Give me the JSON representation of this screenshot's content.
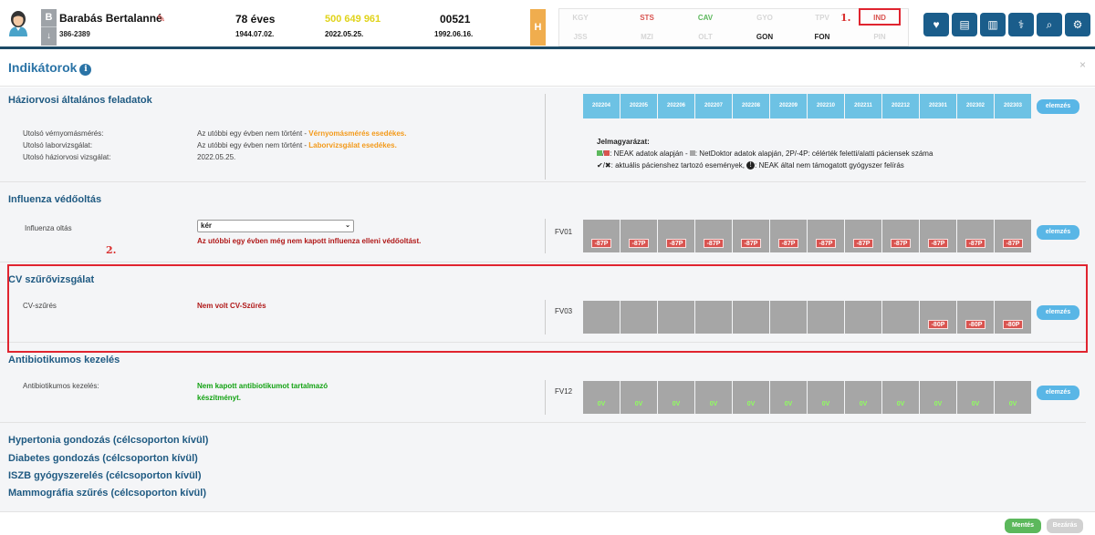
{
  "patient": {
    "initial": "B",
    "name": "Barabás Bertalanné",
    "phone": "386-2389",
    "age": "78 éves",
    "birth_date": "1944.07.02.",
    "taj": "500 649 961",
    "last_visit": "2022.05.25.",
    "code": "00521",
    "code_date": "1992.06.16.",
    "h_label": "H"
  },
  "codes_row1": [
    {
      "label": "KGY",
      "state": "faded"
    },
    {
      "label": "STS",
      "state": "red"
    },
    {
      "label": "CAV",
      "state": "green"
    },
    {
      "label": "GYO",
      "state": "faded"
    },
    {
      "label": "TPV",
      "state": "faded"
    },
    {
      "label": "IND",
      "state": "red"
    }
  ],
  "codes_row2": [
    {
      "label": "JSS",
      "state": "faded"
    },
    {
      "label": "MZI",
      "state": "faded"
    },
    {
      "label": "OLT",
      "state": "faded"
    },
    {
      "label": "GON",
      "state": "dark"
    },
    {
      "label": "FON",
      "state": "dark"
    },
    {
      "label": "PIN",
      "state": "faded"
    }
  ],
  "annotations": {
    "one": "1.",
    "two": "2."
  },
  "colors": {
    "primary": "#1a5d8b",
    "accent": "#59b6e6",
    "highlight": "#e0242f",
    "month": "#6dc2e4"
  },
  "toolbar_icons": [
    "heart-icon",
    "document-icon",
    "books-icon",
    "doctor-icon",
    "search-icon",
    "settings-icon"
  ],
  "modal": {
    "title": "Indikátorok",
    "close": "×",
    "save_label": "Mentés",
    "close_label": "Bezárás"
  },
  "months": [
    "202204",
    "202205",
    "202206",
    "202207",
    "202208",
    "202209",
    "202210",
    "202211",
    "202212",
    "202301",
    "202302",
    "202303"
  ],
  "elemzes_label": "elemzés",
  "haziorvosi": {
    "title": "Háziorvosi általános feladatok",
    "rows": [
      {
        "label": "Utolsó vérnyomásmérés:",
        "value": "Az utóbbi egy évben nem történt - ",
        "warning": "Vérnyomásmérés esedékes."
      },
      {
        "label": "Utolsó laborvizsgálat:",
        "value": "Az utóbbi egy évben nem történt - ",
        "warning": "Laborvizsgálat esedékes."
      },
      {
        "label": "Utolsó háziorvosi vizsgálat:",
        "value": "2022.05.25.",
        "warning": ""
      }
    ],
    "legend": {
      "title": "Jelmagyarázat:",
      "line1": ": NEAK adatok alapján - ",
      "line1b": ": NetDoktor adatok alapján, 2P/-4P: célérték feletti/alatti páciensek száma",
      "line2": "✔/✖: aktuális pácienshez tartozó események, ",
      "line2b": ": NEAK által nem támogatott gyógyszer felírás"
    }
  },
  "influenza": {
    "title": "Influenza védőoltás",
    "label": "Influenza oltás",
    "select_value": "kér",
    "message": "Az utóbbi egy évben még nem kapott influenza elleni védőoltást.",
    "code": "FV01",
    "badges": [
      "-87P",
      "-87P",
      "-87P",
      "-87P",
      "-87P",
      "-87P",
      "-87P",
      "-87P",
      "-87P",
      "-87P",
      "-87P",
      "-87P"
    ]
  },
  "cv": {
    "title": "CV szűrővizsgálat",
    "label": "CV-szűrés",
    "message": "Nem volt CV-Szűrés",
    "code": "FV03",
    "badges": [
      "",
      "",
      "",
      "",
      "",
      "",
      "",
      "",
      "",
      "-80P",
      "-80P",
      "-80P"
    ]
  },
  "antibio": {
    "title": "Antibiotikumos kezelés",
    "label": "Antibiotikumos kezelés:",
    "message1": "Nem kapott antibiotikumot tartalmazó",
    "message2": "készítményt.",
    "code": "FV12",
    "badges": [
      "0V",
      "0V",
      "0V",
      "0V",
      "0V",
      "0V",
      "0V",
      "0V",
      "0V",
      "0V",
      "0V",
      "0V"
    ]
  },
  "other_sections": [
    "Hypertonia gondozás (célcsoporton kívül)",
    "Diabetes gondozás (célcsoporton kívül)",
    "ISZB gyógyszerelés (célcsoporton kívül)",
    "Mammográfia szűrés (célcsoporton kívül)"
  ]
}
